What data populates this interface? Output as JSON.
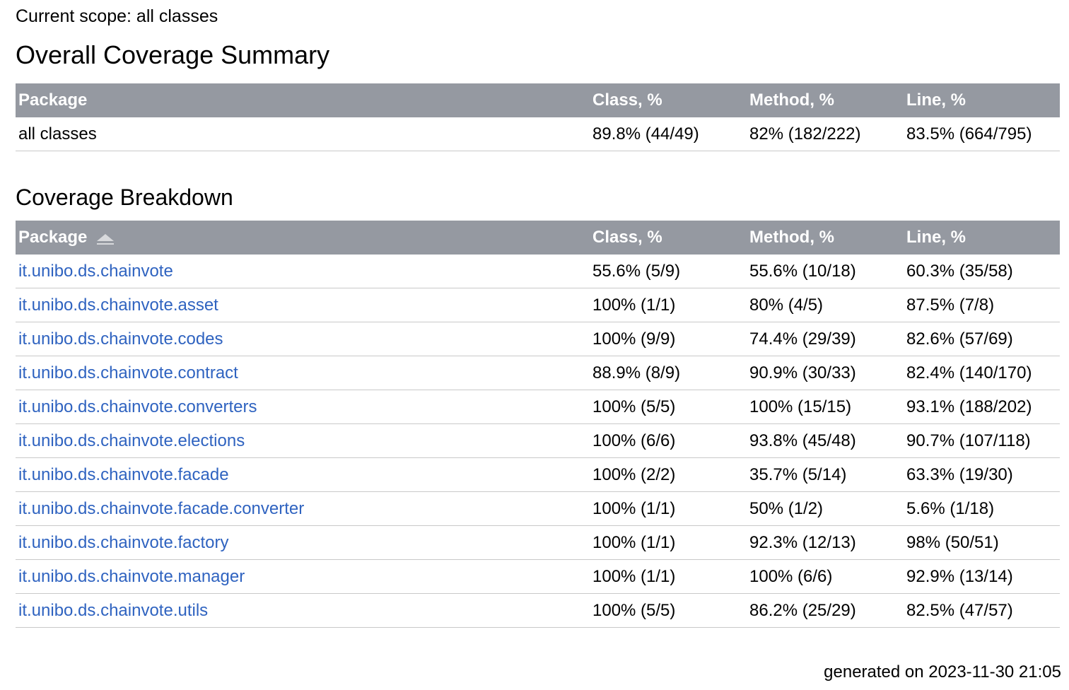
{
  "scope_label": "Current scope: all classes",
  "summary": {
    "title": "Overall Coverage Summary",
    "headers": {
      "package": "Package",
      "class": "Class, %",
      "method": "Method, %",
      "line": "Line, %"
    },
    "row": {
      "name": "all classes",
      "class": "89.8% (44/49)",
      "method": "82% (182/222)",
      "line": "83.5% (664/795)"
    }
  },
  "breakdown": {
    "title": "Coverage Breakdown",
    "headers": {
      "package": "Package",
      "class": "Class, %",
      "method": "Method, %",
      "line": "Line, %"
    },
    "sort_icon": "sort-ascending-icon",
    "rows": [
      {
        "name": "it.unibo.ds.chainvote",
        "class": "55.6% (5/9)",
        "method": "55.6% (10/18)",
        "line": "60.3% (35/58)"
      },
      {
        "name": "it.unibo.ds.chainvote.asset",
        "class": "100% (1/1)",
        "method": "80% (4/5)",
        "line": "87.5% (7/8)"
      },
      {
        "name": "it.unibo.ds.chainvote.codes",
        "class": "100% (9/9)",
        "method": "74.4% (29/39)",
        "line": "82.6% (57/69)"
      },
      {
        "name": "it.unibo.ds.chainvote.contract",
        "class": "88.9% (8/9)",
        "method": "90.9% (30/33)",
        "line": "82.4% (140/170)"
      },
      {
        "name": "it.unibo.ds.chainvote.converters",
        "class": "100% (5/5)",
        "method": "100% (15/15)",
        "line": "93.1% (188/202)"
      },
      {
        "name": "it.unibo.ds.chainvote.elections",
        "class": "100% (6/6)",
        "method": "93.8% (45/48)",
        "line": "90.7% (107/118)"
      },
      {
        "name": "it.unibo.ds.chainvote.facade",
        "class": "100% (2/2)",
        "method": "35.7% (5/14)",
        "line": "63.3% (19/30)"
      },
      {
        "name": "it.unibo.ds.chainvote.facade.converter",
        "class": "100% (1/1)",
        "method": "50% (1/2)",
        "line": "5.6% (1/18)"
      },
      {
        "name": "it.unibo.ds.chainvote.factory",
        "class": "100% (1/1)",
        "method": "92.3% (12/13)",
        "line": "98% (50/51)"
      },
      {
        "name": "it.unibo.ds.chainvote.manager",
        "class": "100% (1/1)",
        "method": "100% (6/6)",
        "line": "92.9% (13/14)"
      },
      {
        "name": "it.unibo.ds.chainvote.utils",
        "class": "100% (5/5)",
        "method": "86.2% (25/29)",
        "line": "82.5% (47/57)"
      }
    ]
  },
  "footer": "generated on 2023-11-30 21:05",
  "colors": {
    "header_bg": "#9599a1",
    "link": "#2f63c0",
    "row_border": "#c9c9c9"
  }
}
